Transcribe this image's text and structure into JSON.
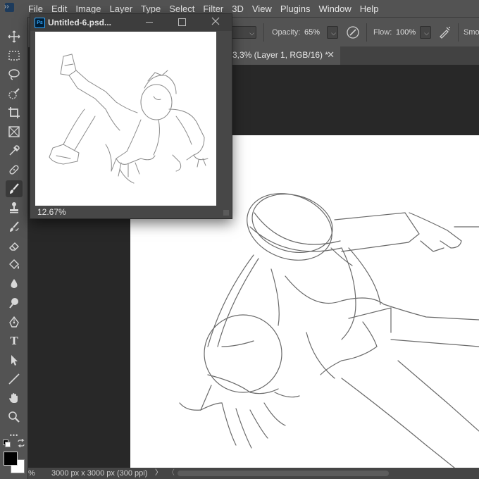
{
  "menu": {
    "items": [
      "File",
      "Edit",
      "Image",
      "Layer",
      "Type",
      "Select",
      "Filter",
      "3D",
      "View",
      "Plugins",
      "Window",
      "Help"
    ]
  },
  "options_bar": {
    "opacity_label": "Opacity:",
    "opacity_value": "65%",
    "flow_label": "Flow:",
    "flow_value": "100%",
    "smoothing_label": "Smo"
  },
  "document_tab": {
    "title": "3,3% (Layer 1, RGB/16) *",
    "close_glyph": "✕"
  },
  "navigator": {
    "app_badge": "Ps",
    "title": "Untitled-6.psd...",
    "zoom": "12.67%"
  },
  "status_bar": {
    "zoom_fragment": "%",
    "doc_info": "3000 px x 3000 px (300 ppi)",
    "arrow": "〉",
    "arrow2": "〈"
  },
  "toolbar": {
    "collapse_glyph": "››",
    "tools": [
      "move-tool",
      "marquee-tool",
      "lasso-tool",
      "quick-selection-tool",
      "crop-tool",
      "frame-tool",
      "eyedropper-tool",
      "healing-brush-tool",
      "brush-tool",
      "clone-stamp-tool",
      "history-brush-tool",
      "eraser-tool",
      "paint-bucket-tool",
      "blur-tool",
      "dodge-tool",
      "pen-tool",
      "type-tool",
      "path-selection-tool",
      "line-tool",
      "hand-tool",
      "zoom-tool",
      "more-tools"
    ],
    "active_tool": "brush-tool",
    "type_glyph": "T",
    "more_glyph": "•••"
  },
  "colors": {
    "foreground": "#000000",
    "background": "#ffffff",
    "ui_panel": "#535353",
    "canvas_bg": "#282828"
  }
}
